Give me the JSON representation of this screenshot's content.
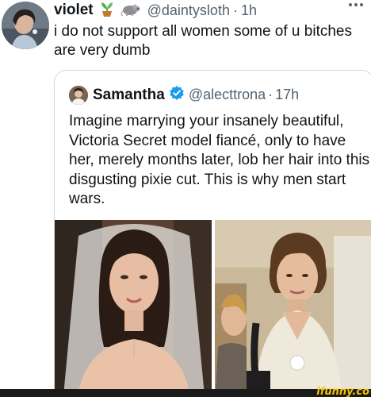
{
  "post": {
    "display_name": "violet",
    "emoji_1": "plant-icon",
    "emoji_2": "rat-icon",
    "handle": "@daintysloth",
    "separator": "·",
    "time": "1h",
    "text": "i do not support all women some of u bitches are very dumb"
  },
  "quote": {
    "display_name": "Samantha",
    "verified": true,
    "handle": "@alecttrona",
    "separator": "·",
    "time": "17h",
    "text": "Imagine marrying your insanely beautiful, Victoria Secret model fiancé, only to have her, merely months later, lob her hair into this disgusting pixie cut. This is why men start wars."
  },
  "watermark": {
    "text": "ifunny.co"
  },
  "colors": {
    "text": "#0f1419",
    "secondary": "#536471",
    "border": "#cfd9de",
    "verified": "#1d9bf0",
    "watermark": "#f5c400"
  }
}
